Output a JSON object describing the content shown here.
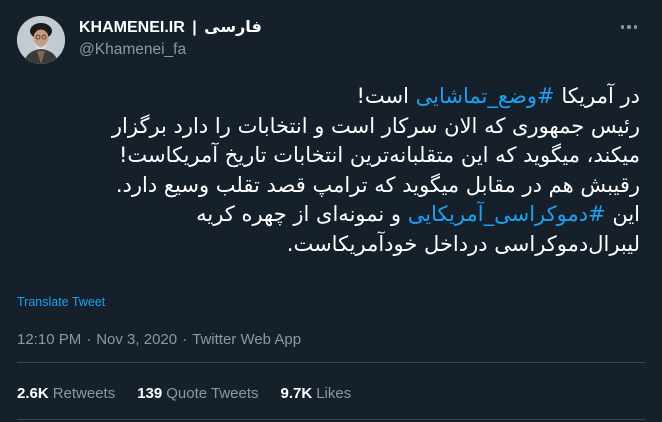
{
  "profile": {
    "display_name": "KHAMENEI.IR",
    "separator": "|",
    "language_label": "فارسی",
    "handle": "@Khamenei_fa",
    "avatar_icon": "profile-portrait"
  },
  "tweet": {
    "lines": [
      {
        "pre": "در آمریکا ",
        "hashtag": "#وضع_تماشایی",
        "post": " است!"
      },
      {
        "pre": "رئیس جمهوری که الان سرکار است و انتخابات را دارد برگزار",
        "hashtag": "",
        "post": ""
      },
      {
        "pre": "میکند، میگوید که این متقلبانه‌ترین انتخابات تاریخ آمریکاست!",
        "hashtag": "",
        "post": ""
      },
      {
        "pre": "رقیبش هم در مقابل میگوید که ترامپ قصد تقلب وسیع دارد.",
        "hashtag": "",
        "post": ""
      },
      {
        "pre": "این ",
        "hashtag": "#دموکراسی_آمریکایی",
        "post": " و نمونه‌ای از چهره کریه"
      },
      {
        "pre": "لیبرال‌دموکراسی درداخل خودآمریکاست.",
        "hashtag": "",
        "post": ""
      }
    ],
    "translate_label": "Translate Tweet",
    "time": "12:10 PM",
    "dot": "·",
    "date": "Nov 3, 2020",
    "source": "Twitter Web App"
  },
  "stats": {
    "retweets_count": "2.6K",
    "retweets_label": "Retweets",
    "quotes_count": "139",
    "quotes_label": "Quote Tweets",
    "likes_count": "9.7K",
    "likes_label": "Likes"
  },
  "colors": {
    "background": "#15202b",
    "link": "#1da1f2",
    "secondary_text": "#8899a6",
    "divider": "#38444d"
  }
}
